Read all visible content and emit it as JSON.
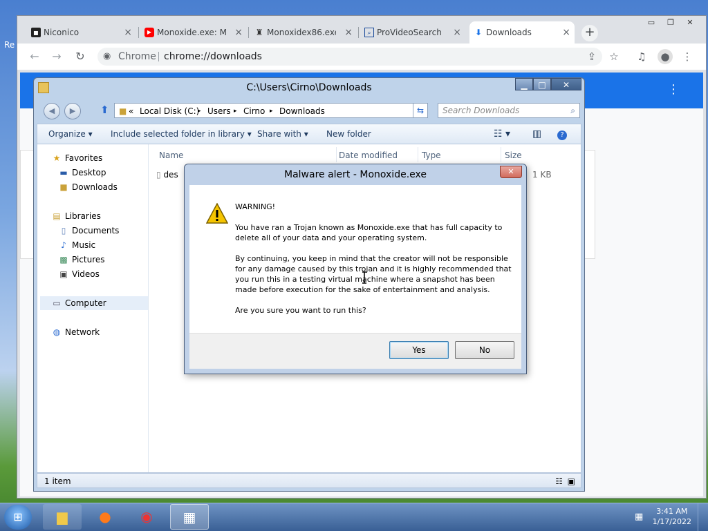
{
  "desktop": {
    "label": "Re"
  },
  "browser": {
    "tabs": [
      {
        "label": "Niconico",
        "icon": "niconico-icon"
      },
      {
        "label": "Monoxide.exe: M",
        "icon": "youtube-icon"
      },
      {
        "label": "Monoxidex86.exe",
        "icon": "site-icon"
      },
      {
        "label": "ProVideoSearch",
        "icon": "search-site-icon"
      },
      {
        "label": "Downloads",
        "icon": "download-icon"
      }
    ],
    "new_tab": "+",
    "omnibox_label": "Chrome",
    "url": "chrome://downloads"
  },
  "explorer": {
    "title": "C:\\Users\\Cirno\\Downloads",
    "breadcrumb": {
      "prefix": "«",
      "c1": "Local Disk (C:)",
      "c2": "Users",
      "c3": "Cirno",
      "c4": "Downloads",
      "sep": "▸"
    },
    "search_placeholder": "Search Downloads",
    "commands": {
      "organize": "Organize ▾",
      "include": "Include selected folder in library ▾",
      "share": "Share with ▾",
      "new_folder": "New folder"
    },
    "nav": {
      "favorites": "Favorites",
      "desktop": "Desktop",
      "downloads": "Downloads",
      "libraries": "Libraries",
      "documents": "Documents",
      "music": "Music",
      "pictures": "Pictures",
      "videos": "Videos",
      "computer": "Computer",
      "network": "Network"
    },
    "columns": {
      "name": "Name",
      "date": "Date modified",
      "type": "Type",
      "size": "Size"
    },
    "file": {
      "name": "des",
      "size": "1 KB"
    },
    "status": "1 item"
  },
  "dialog": {
    "title": "Malware alert - Monoxide.exe",
    "heading": "WARNING!",
    "p1": "You have ran a Trojan known as Monoxide.exe that has full capacity to delete all of your data and your operating system.",
    "p2": "By continuing, you keep in mind that the creator will not be responsible for any damage caused by this trojan and it is highly recommended that you run this in a testing virtual machine where a snapshot has been made before execution for the sake of entertainment and analysis.",
    "p3": "Are you sure you want to run this?",
    "yes": "Yes",
    "no": "No"
  },
  "taskbar": {
    "time": "3:41 AM",
    "date": "1/17/2022"
  }
}
